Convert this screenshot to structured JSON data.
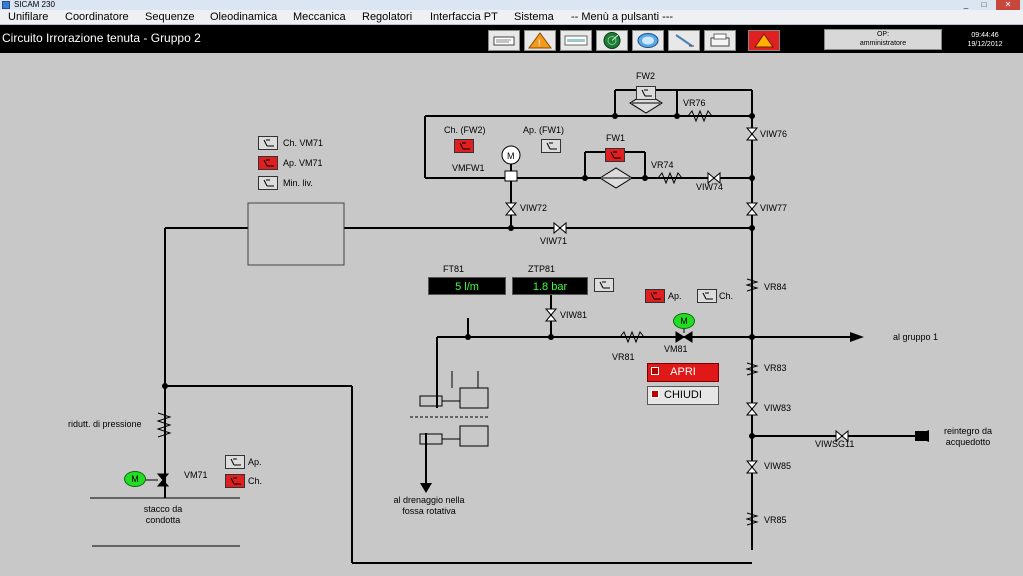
{
  "window": {
    "title": "SICAM 230"
  },
  "menu": [
    "Unifilare",
    "Coordinatore",
    "Sequenze",
    "Oleodinamica",
    "Meccanica",
    "Regolatori",
    "Interfaccia PT",
    "Sistema",
    "-- Menù a pulsanti ---"
  ],
  "header": {
    "title": "Circuito Irrorazione tenuta - Gruppo 2",
    "operator_label": "OP:",
    "operator_name": "amministratore",
    "time": "09:44:46",
    "date": "19/12/2012"
  },
  "toolbar": {
    "icons": [
      "messages-icon",
      "alarm-warning-icon",
      "report-icon",
      "radar-icon",
      "display-icon",
      "pen-icon",
      "printer-icon",
      "alarm-red-icon"
    ]
  },
  "indicators": {
    "ch_vm71": "Ch. VM71",
    "ap_vm71": "Ap. VM71",
    "min_liv": "Min. liv.",
    "ch_fw2": "Ch. (FW2)",
    "ap_fw1": "Ap. (FW1)",
    "vm81_ap": "Ap.",
    "vm81_ch": "Ch.",
    "vm71_ap": "Ap.",
    "vm71_ch": "Ch."
  },
  "labels": {
    "fw2": "FW2",
    "fw1": "FW1",
    "vr76": "VR76",
    "viw76": "VIW76",
    "vmfw1": "VMFW1",
    "vr74": "VR74",
    "viw74": "VIW74",
    "viw72": "VIW72",
    "viw77": "VIW77",
    "viw71": "VIW71",
    "ft81": "FT81",
    "ztp81": "ZTP81",
    "vr84": "VR84",
    "viw81": "VIW81",
    "vr81": "VR81",
    "vm81": "VM81",
    "al_gruppo": "al gruppo 1",
    "vr83": "VR83",
    "viw83": "VIW83",
    "viwsg11": "VIWSG11",
    "reintegro": "reintegro da acquedotto",
    "viw85": "VIW85",
    "vr85": "VR85",
    "riduttore": "ridutt. di pressione",
    "vm71": "VM71",
    "stacco": "stacco da condotta",
    "drenaggio": "al drenaggio nella fossa rotativa",
    "motor": "M"
  },
  "measurements": {
    "ft81": "5 l/m",
    "ztp81": "1.8 bar"
  },
  "controls": {
    "open": "APRI",
    "close": "CHIUDI"
  },
  "colors": {
    "background": "#c8c8c8",
    "active_red": "#e02020",
    "display_green": "#3dff3d",
    "motor_green": "#22dd22"
  }
}
